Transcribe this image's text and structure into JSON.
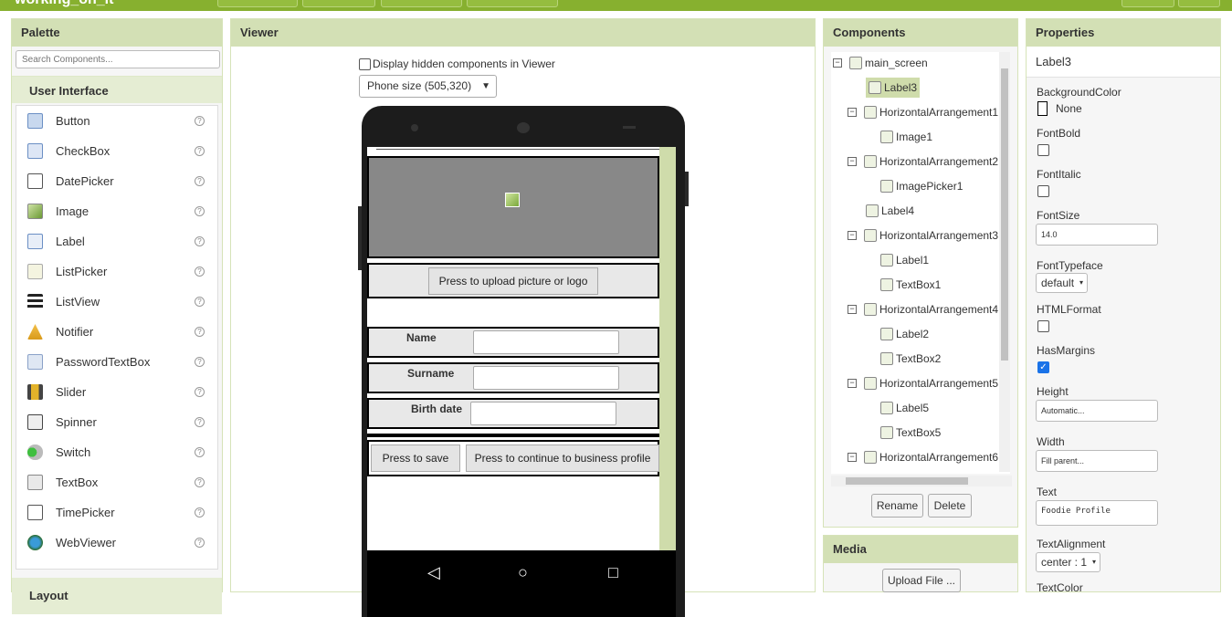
{
  "app": {
    "project_name": "working_on_it"
  },
  "palette": {
    "title": "Palette",
    "search_placeholder": "Search Components...",
    "category_user_interface": "User Interface",
    "category_layout": "Layout",
    "items": [
      {
        "label": "Button",
        "icon": "button-icon"
      },
      {
        "label": "CheckBox",
        "icon": "checkbox-icon"
      },
      {
        "label": "DatePicker",
        "icon": "datepicker-icon"
      },
      {
        "label": "Image",
        "icon": "image-icon"
      },
      {
        "label": "Label",
        "icon": "label-icon"
      },
      {
        "label": "ListPicker",
        "icon": "listpicker-icon"
      },
      {
        "label": "ListView",
        "icon": "listview-icon"
      },
      {
        "label": "Notifier",
        "icon": "notifier-icon"
      },
      {
        "label": "PasswordTextBox",
        "icon": "password-icon"
      },
      {
        "label": "Slider",
        "icon": "slider-icon"
      },
      {
        "label": "Spinner",
        "icon": "spinner-icon"
      },
      {
        "label": "Switch",
        "icon": "switch-icon"
      },
      {
        "label": "TextBox",
        "icon": "textbox-icon"
      },
      {
        "label": "TimePicker",
        "icon": "timepicker-icon"
      },
      {
        "label": "WebViewer",
        "icon": "webviewer-icon"
      }
    ],
    "help_glyph": "?"
  },
  "viewer": {
    "title": "Viewer",
    "hidden_components_label": "Display hidden components in Viewer",
    "phone_size": "Phone size (505,320)",
    "upload_button": "Press to upload picture or logo",
    "name_label": "Name",
    "surname_label": "Surname",
    "birthdate_label": "Birth date",
    "save_button": "Press to save",
    "continue_button": "Press to continue to business profile"
  },
  "components": {
    "title": "Components",
    "tree": [
      {
        "label": "main_screen",
        "toggle": "⊟"
      },
      {
        "label": "Label3",
        "selected": true
      },
      {
        "label": "HorizontalArrangement1",
        "toggle": "⊟"
      },
      {
        "label": "Image1"
      },
      {
        "label": "HorizontalArrangement2",
        "toggle": "⊟"
      },
      {
        "label": "ImagePicker1"
      },
      {
        "label": "Label4"
      },
      {
        "label": "HorizontalArrangement3",
        "toggle": "⊟"
      },
      {
        "label": "Label1"
      },
      {
        "label": "TextBox1"
      },
      {
        "label": "HorizontalArrangement4",
        "toggle": "⊟"
      },
      {
        "label": "Label2"
      },
      {
        "label": "TextBox2"
      },
      {
        "label": "HorizontalArrangement5",
        "toggle": "⊟"
      },
      {
        "label": "Label5"
      },
      {
        "label": "TextBox5"
      },
      {
        "label": "HorizontalArrangement6",
        "toggle": "⊟"
      }
    ],
    "rename_button": "Rename",
    "delete_button": "Delete"
  },
  "media": {
    "title": "Media",
    "upload_button": "Upload File ..."
  },
  "properties": {
    "title": "Properties",
    "component": "Label3",
    "background_color_label": "BackgroundColor",
    "background_color_value": "None",
    "fontbold_label": "FontBold",
    "fontitalic_label": "FontItalic",
    "fontsize_label": "FontSize",
    "fontsize_value": "14.0",
    "fonttypeface_label": "FontTypeface",
    "fonttypeface_value": "default",
    "htmlformat_label": "HTMLFormat",
    "hasmargins_label": "HasMargins",
    "height_label": "Height",
    "height_value": "Automatic...",
    "width_label": "Width",
    "width_value": "Fill parent...",
    "text_label": "Text",
    "text_value": "Foodie Profile",
    "textalignment_label": "TextAlignment",
    "textalignment_value": "center : 1",
    "textcolor_label": "TextColor"
  }
}
